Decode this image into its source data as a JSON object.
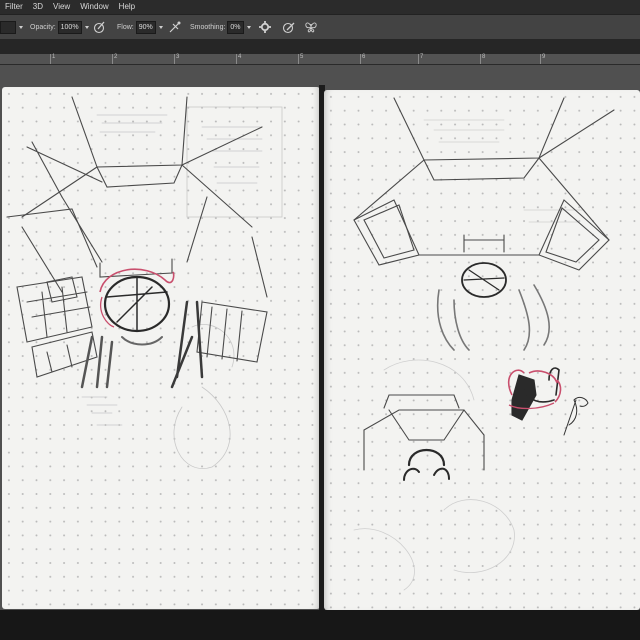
{
  "menu": {
    "items": [
      "Filter",
      "3D",
      "View",
      "Window",
      "Help"
    ]
  },
  "options_bar": {
    "opacity_label": "Opacity:",
    "opacity_value": "100%",
    "flow_label": "Flow:",
    "flow_value": "90%",
    "smoothing_label": "Smoothing:",
    "smoothing_value": "0%"
  },
  "ruler": {
    "numbers": [
      "1",
      "2",
      "3",
      "4",
      "5",
      "6",
      "7",
      "8",
      "9"
    ]
  },
  "icons": {
    "pressure_opacity": "pressure-opacity-icon",
    "airbrush": "airbrush-icon",
    "smoothing_settings": "gear-icon",
    "pressure_size": "pressure-size-icon",
    "symmetry": "butterfly-icon"
  },
  "colors": {
    "menubar_bg": "#2b2b2b",
    "options_bg": "#434343",
    "canvas_bg": "#505050",
    "paper": "#f3f3f1",
    "pencil": "#3c3c3c",
    "red_highlight": "#c94f6d"
  }
}
